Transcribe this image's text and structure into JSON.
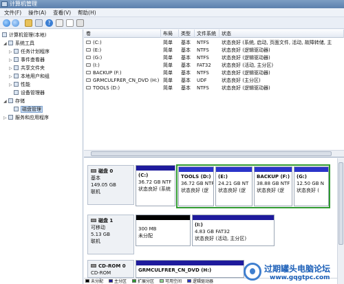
{
  "window": {
    "title": "计算机管理"
  },
  "menu": [
    "文件(F)",
    "操作(A)",
    "查看(V)",
    "帮助(H)"
  ],
  "tree": {
    "items": [
      {
        "label": "计算机管理(本地)",
        "toggle": "",
        "icon": "computer-icon"
      },
      {
        "label": "系统工具",
        "toggle": "◢",
        "icon": "tools-icon"
      },
      {
        "label": "任务计划程序",
        "toggle": "▷",
        "icon": "clock-icon"
      },
      {
        "label": "事件查看器",
        "toggle": "▷",
        "icon": "event-viewer-icon"
      },
      {
        "label": "共享文件夹",
        "toggle": "▷",
        "icon": "shared-folder-icon"
      },
      {
        "label": "本地用户和组",
        "toggle": "▷",
        "icon": "users-icon"
      },
      {
        "label": "性能",
        "toggle": "▷",
        "icon": "performance-icon"
      },
      {
        "label": "设备管理器",
        "toggle": "",
        "icon": "device-manager-icon"
      },
      {
        "label": "存储",
        "toggle": "◢",
        "icon": "storage-icon"
      },
      {
        "label": "磁盘管理",
        "toggle": "",
        "icon": "disk-management-icon"
      },
      {
        "label": "服务和应用程序",
        "toggle": "▷",
        "icon": "services-icon"
      }
    ]
  },
  "volume_list": {
    "headers": [
      "卷",
      "布局",
      "类型",
      "文件系统",
      "状态"
    ],
    "rows": [
      [
        "(C:)",
        "简单",
        "基本",
        "NTFS",
        "状态良好 (系统, 启动, 页面文件, 活动, 故障转储, 主"
      ],
      [
        "(E:)",
        "简单",
        "基本",
        "NTFS",
        "状态良好 (逻辑驱动器)"
      ],
      [
        "(G:)",
        "简单",
        "基本",
        "NTFS",
        "状态良好 (逻辑驱动器)"
      ],
      [
        "(I:)",
        "简单",
        "基本",
        "FAT32",
        "状态良好 (活动, 主分区)"
      ],
      [
        "BACKUP (F:)",
        "简单",
        "基本",
        "NTFS",
        "状态良好 (逻辑驱动器)"
      ],
      [
        "GRMCULFRER_CN_DVD (H:)",
        "简单",
        "基本",
        "UDF",
        "状态良好 (主分区)"
      ],
      [
        "TOOLS (D:)",
        "简单",
        "基本",
        "NTFS",
        "状态良好 (逻辑驱动器)"
      ]
    ]
  },
  "disks": [
    {
      "name": "磁盘 0",
      "type": "基本",
      "size": "149.05 GB",
      "status": "联机",
      "partitions": [
        {
          "title": "(C:)",
          "size": "36.72 GB NTF",
          "state": "状态良好 (系统"
        },
        {
          "title": "TOOLS (D:)",
          "size": "36.72 GB NTF",
          "state": "状态良好 (逻"
        },
        {
          "title": "(E:)",
          "size": "24.21 GB NT",
          "state": "状态良好 (逻"
        },
        {
          "title": "BACKUP (F:)",
          "size": "38.88 GB NTF",
          "state": "状态良好 (逻"
        },
        {
          "title": "(G:)",
          "size": "12.50 GB N",
          "state": "状态良好 ("
        }
      ]
    },
    {
      "name": "磁盘 1",
      "type": "可移动",
      "size": "5.13 GB",
      "status": "联机",
      "partitions": [
        {
          "title": "",
          "size": "300 MB",
          "state": "未分配"
        },
        {
          "title": "(I:)",
          "size": "4.83 GB FAT32",
          "state": "状态良好 (活动, 主分区)"
        }
      ]
    },
    {
      "name": "CD-ROM 0",
      "type": "CD-ROM",
      "size": "",
      "status": "",
      "partitions": [
        {
          "title": "GRMCULFRER_CN_DVD  (H:)",
          "size": "",
          "state": ""
        }
      ]
    }
  ],
  "legend": [
    {
      "label": "未分配",
      "color": "#000000"
    },
    {
      "label": "主分区",
      "color": "#1e1a9c"
    },
    {
      "label": "扩展分区",
      "color": "#2f9a2f"
    },
    {
      "label": "可用空间",
      "color": "#8fd88f"
    },
    {
      "label": "逻辑驱动器",
      "color": "#2b35c9"
    }
  ],
  "watermark": {
    "line1": "过期罐头电脑论坛",
    "line2": "www.gqgtpc.com"
  }
}
